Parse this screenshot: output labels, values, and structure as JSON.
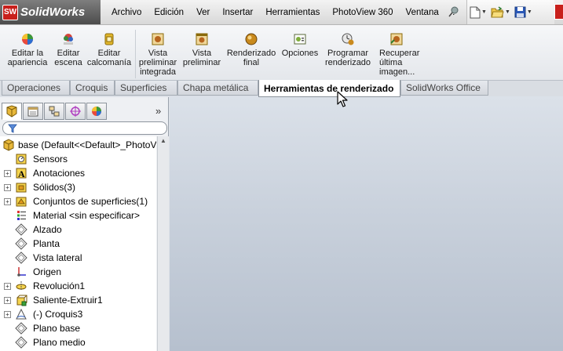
{
  "app": {
    "name": "SolidWorks",
    "badge": "SW"
  },
  "menu": [
    "Archivo",
    "Edición",
    "Ver",
    "Insertar",
    "Herramientas",
    "PhotoView 360",
    "Ventana",
    "?"
  ],
  "ribbon": {
    "commands": [
      {
        "label": "Editar la apariencia",
        "icon": "appearance-sphere-icon"
      },
      {
        "label": "Editar escena",
        "icon": "scene-icon"
      },
      {
        "label": "Editar calcomanía",
        "icon": "decal-icon"
      },
      {
        "label": "Vista preliminar integrada",
        "icon": "integrated-preview-icon"
      },
      {
        "label": "Vista preliminar",
        "icon": "preview-window-icon"
      },
      {
        "label": "Renderizado final",
        "icon": "final-render-icon"
      },
      {
        "label": "Opciones",
        "icon": "options-icon"
      },
      {
        "label": "Programar renderizado",
        "icon": "schedule-render-icon"
      },
      {
        "label": "Recuperar última imagen...",
        "icon": "recall-last-image-icon"
      }
    ]
  },
  "tabs": [
    {
      "label": "Operaciones",
      "active": false
    },
    {
      "label": "Croquis",
      "active": false
    },
    {
      "label": "Superficies",
      "active": false
    },
    {
      "label": "Chapa metálica",
      "active": false
    },
    {
      "label": "Herramientas de renderizado",
      "active": true
    },
    {
      "label": "SolidWorks Office",
      "active": false
    }
  ],
  "feature_manager": {
    "panel_tabs": [
      "featuremanager-tree-icon",
      "property-manager-icon",
      "configuration-manager-icon",
      "dimxpert-icon",
      "display-manager-icon"
    ],
    "root": "base  (Default<<Default>_PhotoV",
    "items": [
      {
        "label": "Sensors",
        "expandable": false,
        "icon": "sensors-icon"
      },
      {
        "label": "Anotaciones",
        "expandable": true,
        "icon": "annotations-icon"
      },
      {
        "label": "Sólidos(3)",
        "expandable": true,
        "icon": "solid-bodies-icon"
      },
      {
        "label": "Conjuntos de superficies(1)",
        "expandable": true,
        "icon": "surface-bodies-icon"
      },
      {
        "label": "Material <sin especificar>",
        "expandable": false,
        "icon": "material-icon"
      },
      {
        "label": "Alzado",
        "expandable": false,
        "icon": "plane-icon"
      },
      {
        "label": "Planta",
        "expandable": false,
        "icon": "plane-icon"
      },
      {
        "label": "Vista lateral",
        "expandable": false,
        "icon": "plane-icon"
      },
      {
        "label": "Origen",
        "expandable": false,
        "icon": "origin-icon"
      },
      {
        "label": "Revolución1",
        "expandable": true,
        "icon": "revolve-icon"
      },
      {
        "label": "Saliente-Extruir1",
        "expandable": true,
        "icon": "extrude-icon"
      },
      {
        "label": "(-) Croquis3",
        "expandable": true,
        "icon": "sketch-icon"
      },
      {
        "label": "Plano base",
        "expandable": false,
        "icon": "plane-icon"
      },
      {
        "label": "Plano medio",
        "expandable": false,
        "icon": "plane-icon"
      }
    ]
  },
  "colors": {
    "sw_red": "#c8201c",
    "viewport_top": "#dbe1e9",
    "viewport_bottom": "#b6c0ce"
  }
}
